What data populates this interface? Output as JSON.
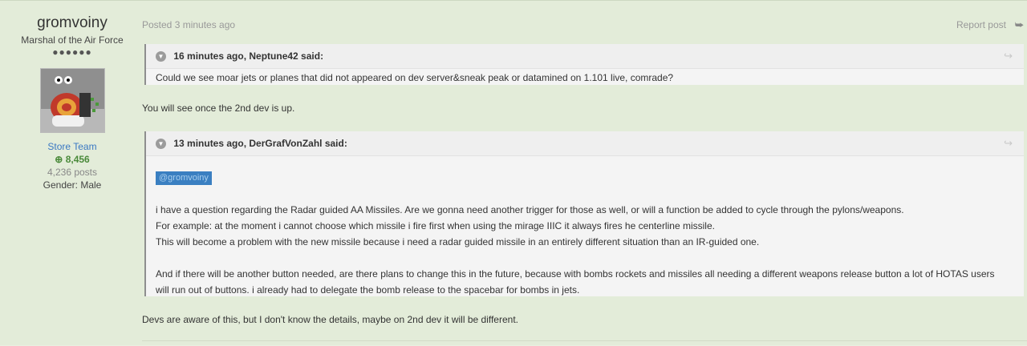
{
  "author": {
    "name": "gromvoiny",
    "rank": "Marshal of the Air Force",
    "pips": "●●●●●●",
    "team": "Store Team",
    "reputation": "8,456",
    "posts": "4,236 posts",
    "gender": "Gender: Male"
  },
  "post": {
    "posted": "Posted 3 minutes ago",
    "report_label": "Report post"
  },
  "quotes": [
    {
      "header": "16 minutes ago, Neptune42 said:",
      "lines": [
        "Could we see moar jets or planes that did not appeared on dev server&sneak peak or datamined on 1.101 live, comrade?"
      ]
    },
    {
      "header": "13 minutes ago, DerGrafVonZahl said:",
      "mention": "@gromvoiny",
      "lines": [
        "i have a question regarding the Radar guided AA Missiles. Are we gonna need another trigger for those as well, or will a function be added to cycle through the pylons/weapons.",
        "For example: at the moment i cannot choose which missile i fire first when using the mirage IIIC it always fires he centerline missile.",
        "This will become a problem with the new missile because i need a radar guided missile in an entirely different situation than an IR-guided one.",
        "And if there will be another button needed, are there plans to change this in the future, because with bombs rockets and missiles all needing a different weapons release button a lot of HOTAS users",
        "will run out of buttons. i already had to delegate the bomb release to the spacebar for bombs in jets."
      ]
    }
  ],
  "replies": [
    "You will see once the 2nd dev is up.",
    "Devs are aware of this, but I don't know the details, maybe on 2nd dev it will be different."
  ],
  "icons": {
    "quote_collapse": "chevron-down-icon",
    "quote_link": "arrow-icon",
    "share": "share-icon",
    "reputation": "plus-circle-icon"
  }
}
